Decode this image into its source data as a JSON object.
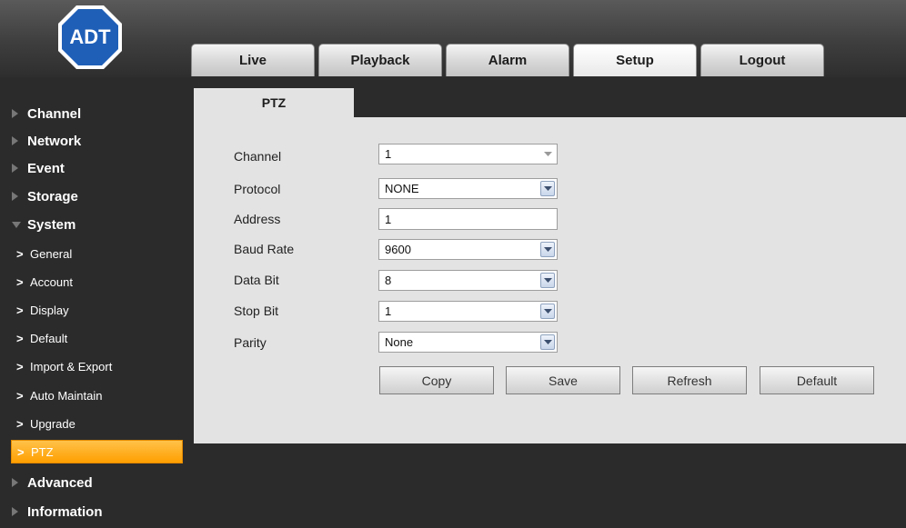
{
  "brand": {
    "logo_text": "ADT",
    "logo_color": "#1f5fb8"
  },
  "top_tabs": [
    {
      "label": "Live"
    },
    {
      "label": "Playback"
    },
    {
      "label": "Alarm"
    },
    {
      "label": "Setup",
      "active": true
    },
    {
      "label": "Logout"
    }
  ],
  "sidebar": {
    "sections": [
      {
        "label": "Channel"
      },
      {
        "label": "Network"
      },
      {
        "label": "Event"
      },
      {
        "label": "Storage"
      },
      {
        "label": "System",
        "expanded": true
      },
      {
        "label": "Advanced"
      },
      {
        "label": "Information"
      }
    ],
    "system_items": [
      {
        "label": "General"
      },
      {
        "label": "Account"
      },
      {
        "label": "Display"
      },
      {
        "label": "Default"
      },
      {
        "label": "Import & Export"
      },
      {
        "label": "Auto Maintain"
      },
      {
        "label": "Upgrade"
      },
      {
        "label": "PTZ",
        "active": true
      }
    ],
    "active_color": "#ffa500"
  },
  "content": {
    "tab_label": "PTZ",
    "fields": {
      "channel": {
        "label": "Channel",
        "value": "1"
      },
      "protocol": {
        "label": "Protocol",
        "value": "NONE"
      },
      "address": {
        "label": "Address",
        "value": "1"
      },
      "baud_rate": {
        "label": "Baud Rate",
        "value": "9600"
      },
      "data_bit": {
        "label": "Data Bit",
        "value": "8"
      },
      "stop_bit": {
        "label": "Stop Bit",
        "value": "1"
      },
      "parity": {
        "label": "Parity",
        "value": "None"
      }
    },
    "buttons": {
      "copy": "Copy",
      "save": "Save",
      "refresh": "Refresh",
      "default": "Default"
    }
  }
}
